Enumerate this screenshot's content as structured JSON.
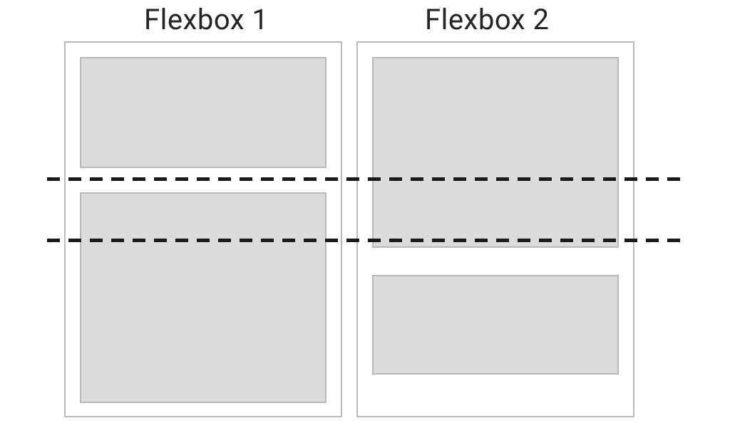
{
  "diagram": {
    "headings": {
      "flexbox1": "Flexbox 1",
      "flexbox2": "Flexbox 2"
    },
    "colors": {
      "container_border": "#b9b9b9",
      "item_fill": "#dcdcdc",
      "item_border": "#b9b9b9",
      "dash_color": "#1a1a1a",
      "text_color": "#242424",
      "background": "#ffffff"
    }
  }
}
